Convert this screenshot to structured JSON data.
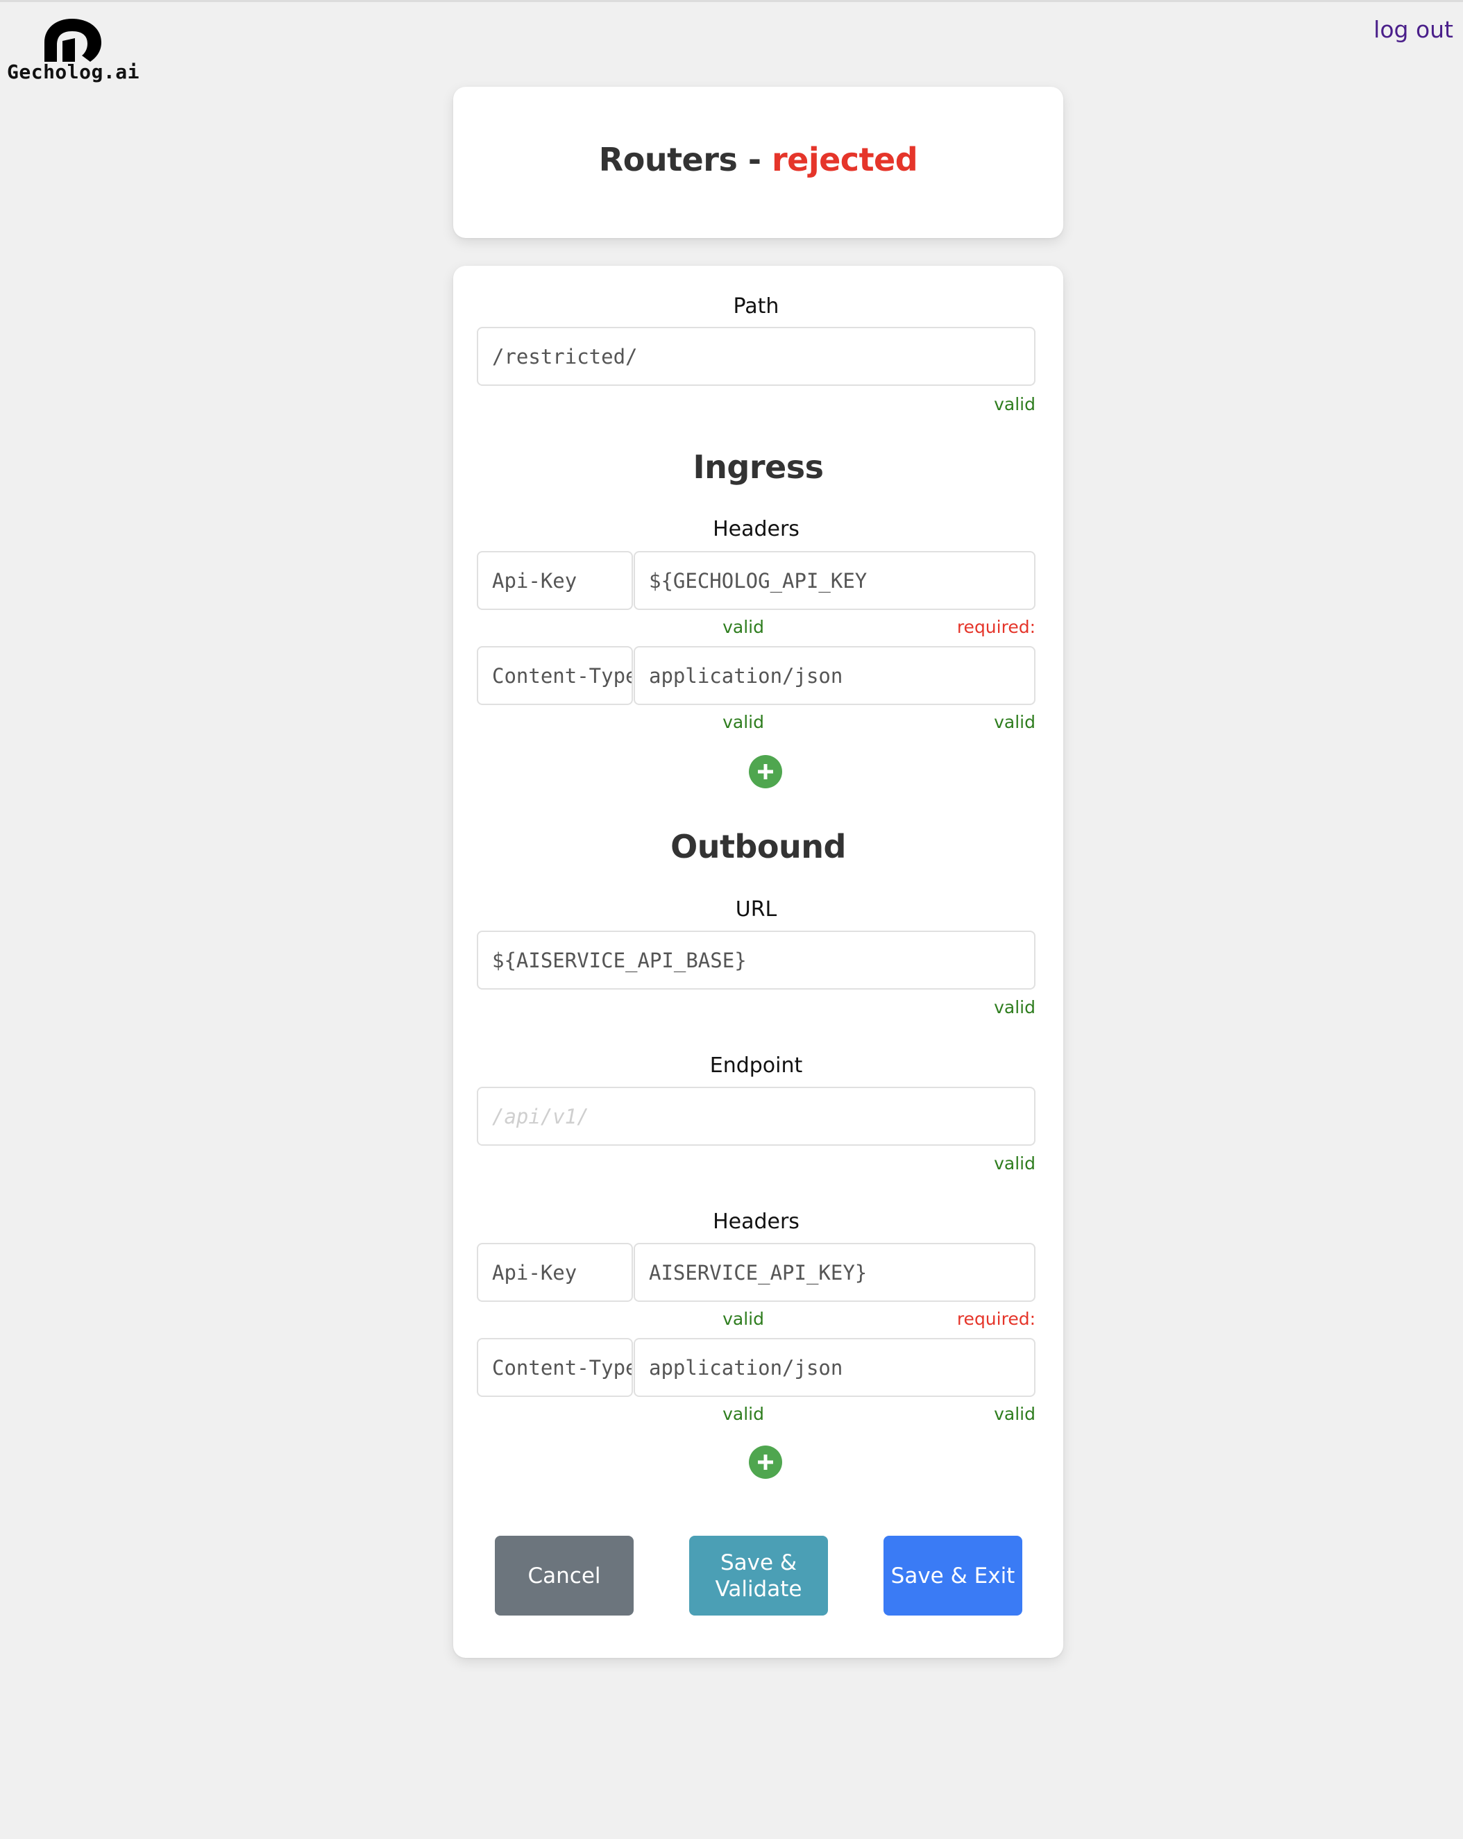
{
  "header": {
    "logo_text": "Gecholog.ai",
    "logo_icon": "gecholog-g-logo-icon",
    "logout_label": "log out"
  },
  "title": {
    "prefix": "Routers - ",
    "status": "rejected"
  },
  "form": {
    "path": {
      "label": "Path",
      "value": "/restricted/",
      "status": "valid"
    },
    "ingress": {
      "heading": "Ingress",
      "headers_label": "Headers",
      "headers": [
        {
          "key": "Api-Key",
          "key_status": "valid",
          "value": "${GECHOLOG_API_KEY",
          "value_status": "required:"
        },
        {
          "key": "Content-Type",
          "key_status": "valid",
          "value": "application/json",
          "value_status": "valid"
        }
      ],
      "add_icon": "plus-icon"
    },
    "outbound": {
      "heading": "Outbound",
      "url": {
        "label": "URL",
        "value": "${AISERVICE_API_BASE}",
        "status": "valid"
      },
      "endpoint": {
        "label": "Endpoint",
        "value": "",
        "placeholder": "/api/v1/",
        "status": "valid"
      },
      "headers_label": "Headers",
      "headers": [
        {
          "key": "Api-Key",
          "key_status": "valid",
          "value": "AISERVICE_API_KEY}",
          "value_status": "required:"
        },
        {
          "key": "Content-Type",
          "key_status": "valid",
          "value": "application/json",
          "value_status": "valid"
        }
      ],
      "add_icon": "plus-icon"
    }
  },
  "actions": {
    "cancel_label": "Cancel",
    "save_validate_label": "Save & Validate",
    "save_exit_label": "Save & Exit"
  },
  "colors": {
    "background": "#f0f0f0",
    "status_rejected": "#e5352a",
    "valid": "#2e7d1e",
    "required": "#e5352a",
    "add_button": "#4fa64f",
    "cancel_button": "#6c757d",
    "save_validate_button": "#4b9fb5",
    "save_exit_button": "#3a7bf5",
    "logout_link": "#4a1f8a"
  }
}
